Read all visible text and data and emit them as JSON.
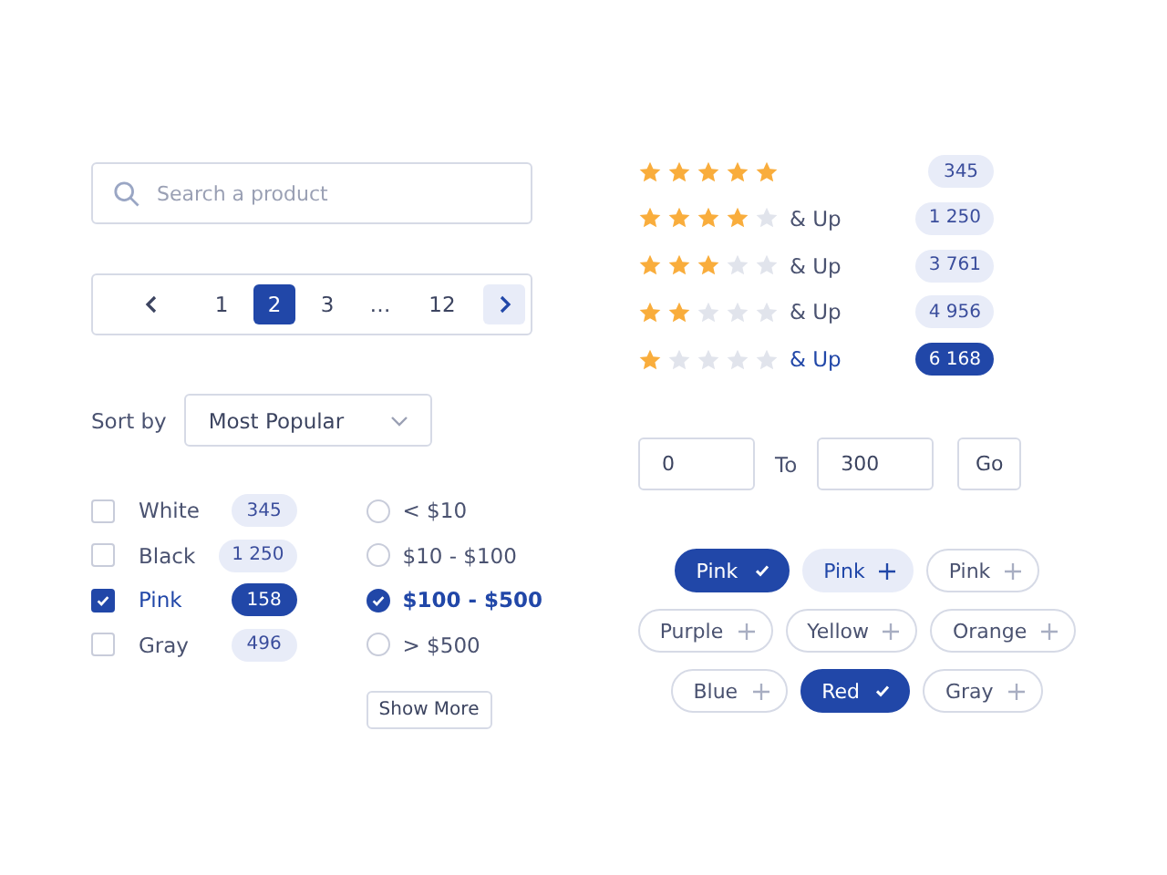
{
  "search": {
    "placeholder": "Search a product"
  },
  "pagination": {
    "pages": [
      {
        "label": "1",
        "selected": false
      },
      {
        "label": "2",
        "selected": true
      },
      {
        "label": "3",
        "selected": false
      },
      {
        "label": "…",
        "selected": false
      },
      {
        "label": "12",
        "selected": false
      }
    ],
    "next_hovered": true
  },
  "sort": {
    "label": "Sort by",
    "value": "Most Popular"
  },
  "colors": [
    {
      "label": "White",
      "count": "345",
      "checked": false
    },
    {
      "label": "Black",
      "count": "1 250",
      "checked": false
    },
    {
      "label": "Pink",
      "count": "158",
      "checked": true
    },
    {
      "label": "Gray",
      "count": "496",
      "checked": false
    }
  ],
  "prices": [
    {
      "label": "< $10",
      "selected": false
    },
    {
      "label": "$10 - $100",
      "selected": false
    },
    {
      "label": "$100 - $500",
      "selected": true
    },
    {
      "label": "> $500",
      "selected": false
    }
  ],
  "show_more": "Show More",
  "ratings": [
    {
      "stars": 5,
      "count": "345",
      "selected": false
    },
    {
      "stars": 4,
      "label": "& Up",
      "count": "1 250",
      "selected": false
    },
    {
      "stars": 3,
      "label": "& Up",
      "count": "3 761",
      "selected": false
    },
    {
      "stars": 2,
      "label": "& Up",
      "count": "4 956",
      "selected": false
    },
    {
      "stars": 1,
      "label": "& Up",
      "count": "6 168",
      "selected": true
    }
  ],
  "range": {
    "from": "0",
    "separator": "To",
    "to": "300",
    "button": "Go"
  },
  "tag_rows": [
    [
      {
        "label": "Pink",
        "selected": true,
        "hovered": false
      },
      {
        "label": "Pink",
        "selected": false,
        "hovered": true
      },
      {
        "label": "Pink",
        "selected": false,
        "hovered": false
      }
    ],
    [
      {
        "label": "Purple",
        "selected": false,
        "hovered": false
      },
      {
        "label": "Yellow",
        "selected": false,
        "hovered": false
      },
      {
        "label": "Orange",
        "selected": false,
        "hovered": false
      }
    ],
    [
      {
        "label": "Blue",
        "selected": false,
        "hovered": false
      },
      {
        "label": "Red",
        "selected": true,
        "hovered": false
      },
      {
        "label": "Gray",
        "selected": false,
        "hovered": false
      }
    ]
  ]
}
